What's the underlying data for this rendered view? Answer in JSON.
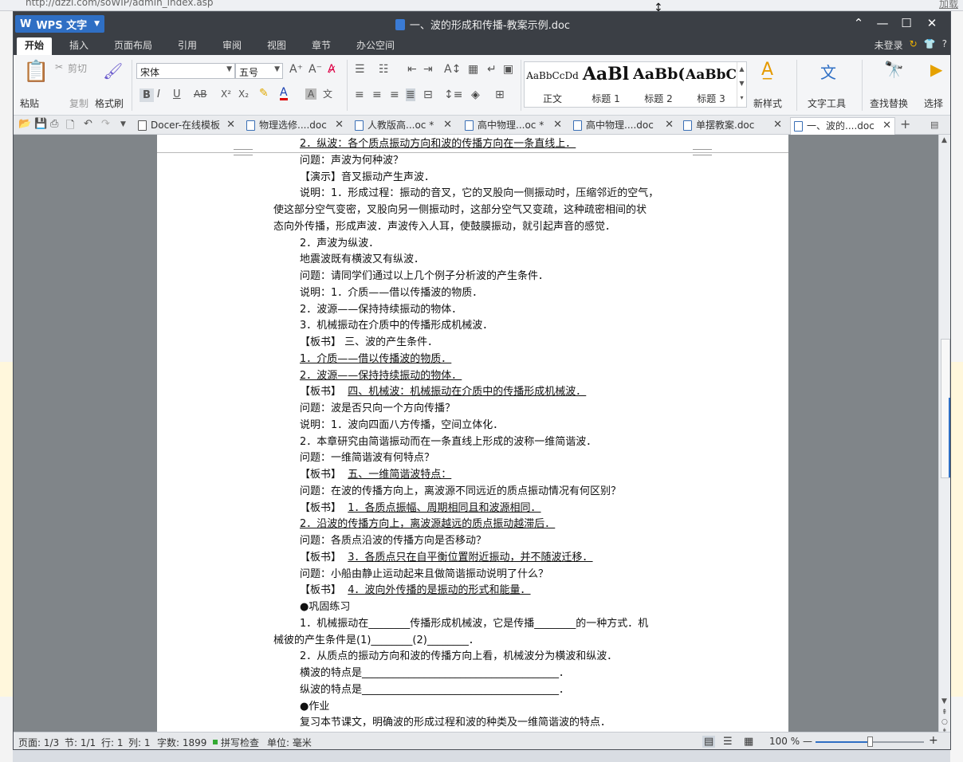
{
  "browser": {
    "url": "http://dzzl.com/soWIP/admin_index.asp",
    "right_link": "加载"
  },
  "window": {
    "app_name": "WPS 文字",
    "doc_title": "一、波的形成和传播-教案示例.doc",
    "controls": {
      "chevron": "⌃",
      "minimize": "—",
      "maximize": "☐",
      "close": "✕"
    }
  },
  "menu": {
    "tabs": [
      "开始",
      "插入",
      "页面布局",
      "引用",
      "审阅",
      "视图",
      "章节",
      "办公空间"
    ],
    "active": "开始",
    "login": "未登录",
    "help": "?"
  },
  "ribbon": {
    "paste": "粘贴",
    "cut": "剪切",
    "copy": "复制",
    "format_painter": "格式刷",
    "font_name": "宋体",
    "font_size": "五号",
    "styles": [
      {
        "preview": "AaBbCcDd",
        "label": "正文"
      },
      {
        "preview": "AaBl",
        "label": "标题 1"
      },
      {
        "preview": "AaBb(",
        "label": "标题 2"
      },
      {
        "preview": "AaBbC",
        "label": "标题 3"
      }
    ],
    "new_style": "新样式",
    "text_tools": "文字工具",
    "find_replace": "查找替换",
    "select": "选择"
  },
  "tabs": [
    {
      "label": "Docer-在线模板",
      "active": false
    },
    {
      "label": "物理选修....doc",
      "active": false
    },
    {
      "label": "人教版高...oc *",
      "active": false
    },
    {
      "label": "高中物理...oc *",
      "active": false
    },
    {
      "label": "高中物理....doc",
      "active": false
    },
    {
      "label": "单摆教案.doc",
      "active": false
    },
    {
      "label": "一、波的....doc",
      "active": true
    }
  ],
  "document": {
    "lines": [
      {
        "text": "2．纵波：各个质点振动方向和波的传播方向在一条直线上．",
        "indent": 1,
        "u": true
      },
      {
        "text": "问题：声波为何种波？",
        "indent": 1
      },
      {
        "text": "【演示】音叉振动产生声波．",
        "indent": 1
      },
      {
        "text": "说明：1．形成过程：振动的音叉，它的叉股向一侧振动时，压缩邻近的空气，",
        "indent": 1
      },
      {
        "text": "使这部分空气变密，叉股向另一侧振动时，这部分空气又变疏，这种疏密相间的状",
        "indent": 0
      },
      {
        "text": "态向外传播，形成声波．声波传入人耳，使鼓膜振动，就引起声音的感觉．",
        "indent": 0
      },
      {
        "text": "2．声波为纵波．",
        "indent": 1
      },
      {
        "text": "地震波既有横波又有纵波．",
        "indent": 1
      },
      {
        "text": "问题：请同学们通过以上几个例子分析波的产生条件．",
        "indent": 1
      },
      {
        "text": "说明：1．介质——借以传播波的物质．",
        "indent": 1
      },
      {
        "text": "2．波源——保持持续振动的物体．",
        "indent": 1
      },
      {
        "text": "3．机械振动在介质中的传播形成机械波．",
        "indent": 1
      },
      {
        "text": "【板书】  三、波的产生条件．",
        "indent": 1
      },
      {
        "text": "1．介质——借以传播波的物质．",
        "indent": 1,
        "u": true
      },
      {
        "text": "2．波源——保持持续振动的物体．",
        "indent": 1,
        "u": true
      },
      {
        "pre": "【板书】  ",
        "text": "四、机械波：机械振动在介质中的传播形成机械波．",
        "indent": 1,
        "u": true
      },
      {
        "text": "问题：波是否只向一个方向传播？",
        "indent": 1
      },
      {
        "text": "说明：1．波向四面八方传播，空间立体化．",
        "indent": 1
      },
      {
        "text": "2．本章研究由简谐振动而在一条直线上形成的波称一维简谐波．",
        "indent": 1
      },
      {
        "text": "问题：一维简谐波有何特点？",
        "indent": 1
      },
      {
        "pre": "【板书】  ",
        "text": "五、一维简谐波特点：",
        "indent": 1,
        "u": true
      },
      {
        "text": "问题：在波的传播方向上，离波源不同远近的质点振动情况有何区别？",
        "indent": 1
      },
      {
        "pre": "【板书】  ",
        "text": "1．各质点振幅、周期相同且和波源相同．",
        "indent": 1,
        "u": true
      },
      {
        "text": "2．沿波的传播方向上，离波源越远的质点振动越滞后．",
        "indent": 1,
        "u": true
      },
      {
        "text": "问题：各质点沿波的传播方向是否移动？",
        "indent": 1
      },
      {
        "pre": "【板书】  ",
        "text": "3．各质点只在自平衡位置附近振动，并不随波迁移．",
        "indent": 1,
        "u": true
      },
      {
        "text": "问题：小船由静止运动起来且做简谐振动说明了什么？",
        "indent": 1
      },
      {
        "pre": "【板书】  ",
        "text": "4．波向外传播的是振动的形式和能量．",
        "indent": 1,
        "u": true
      },
      {
        "text": "●巩固练习",
        "indent": 1
      },
      {
        "text": "1．机械振动在________传播形成机械波，它是传播________的一种方式．机",
        "indent": 1
      },
      {
        "text": "械彼的产生条件是(1)________(2)________．",
        "indent": 0
      },
      {
        "text": "2．从质点的振动方向和波的传播方向上看，机械波分为横波和纵波．",
        "indent": 1
      },
      {
        "text": "横波的特点是______________________________________．",
        "indent": 1
      },
      {
        "text": "纵波的特点是______________________________________．",
        "indent": 1
      },
      {
        "text": "●作业",
        "indent": 1
      },
      {
        "text": "复习本节课文，明确波的形成过程和波的种类及一维简谐波的特点．",
        "indent": 1
      }
    ]
  },
  "status": {
    "page": "页面: 1/3",
    "section": "节: 1/1",
    "row": "行: 1",
    "col": "列: 1",
    "words": "字数: 1899",
    "spell": "拼写检查",
    "unit": "单位: 毫米",
    "zoom": "100 %",
    "zoom_minus": "—",
    "zoom_plus": "+"
  }
}
